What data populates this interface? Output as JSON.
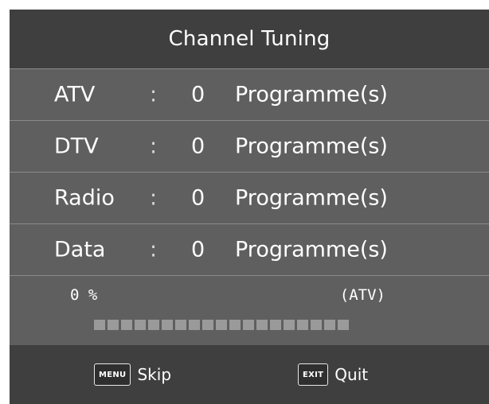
{
  "window": {
    "title": "Channel Tuning"
  },
  "rows": [
    {
      "name": "ATV",
      "separator": ":",
      "count": "0",
      "unit": "Programme(s)"
    },
    {
      "name": "DTV",
      "separator": ":",
      "count": "0",
      "unit": "Programme(s)"
    },
    {
      "name": "Radio",
      "separator": ":",
      "count": "0",
      "unit": "Programme(s)"
    },
    {
      "name": "Data",
      "separator": ":",
      "count": "0",
      "unit": "Programme(s)"
    }
  ],
  "progress": {
    "percent_label": "0 %",
    "mode_label": "(ATV)",
    "value": 0,
    "segment_count": 19
  },
  "footer": {
    "skip": {
      "key": "MENU",
      "label": "Skip",
      "icon": "menu-key-icon"
    },
    "quit": {
      "key": "EXIT",
      "label": "Quit",
      "icon": "exit-key-icon"
    }
  },
  "colors": {
    "panel": "#5f5f5f",
    "bar": "#3f3f3f",
    "divider": "#8a8a8a",
    "segment_empty": "#9a9a9a",
    "text": "#ffffff"
  }
}
